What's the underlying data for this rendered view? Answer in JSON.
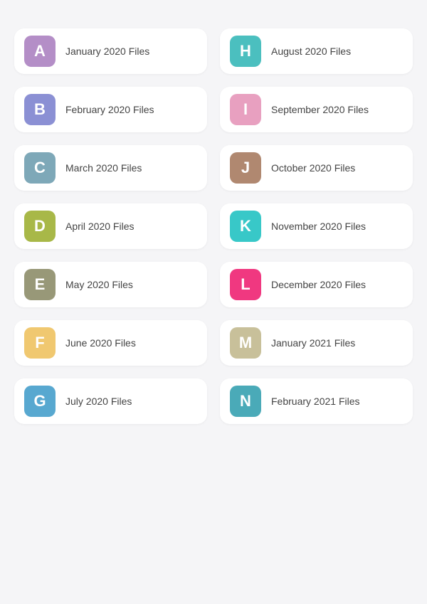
{
  "folders": [
    {
      "id": "A",
      "label": "January 2020 Files",
      "color": "#b48ec7"
    },
    {
      "id": "H",
      "label": "August 2020 Files",
      "color": "#4bbfbf"
    },
    {
      "id": "B",
      "label": "February 2020 Files",
      "color": "#8b90d4"
    },
    {
      "id": "I",
      "label": "September 2020 Files",
      "color": "#e8a0c0"
    },
    {
      "id": "C",
      "label": "March 2020 Files",
      "color": "#7ea8b8"
    },
    {
      "id": "J",
      "label": "October 2020 Files",
      "color": "#b08870"
    },
    {
      "id": "D",
      "label": "April 2020 Files",
      "color": "#a8b848"
    },
    {
      "id": "K",
      "label": "November 2020 Files",
      "color": "#38c8c8"
    },
    {
      "id": "E",
      "label": "May 2020 Files",
      "color": "#989878"
    },
    {
      "id": "L",
      "label": "December 2020 Files",
      "color": "#f03880"
    },
    {
      "id": "F",
      "label": "June 2020 Files",
      "color": "#f0c870"
    },
    {
      "id": "M",
      "label": "January 2021 Files",
      "color": "#c8c09a"
    },
    {
      "id": "G",
      "label": "July 2020 Files",
      "color": "#58a8d0"
    },
    {
      "id": "N",
      "label": "February 2021 Files",
      "color": "#4aaab8"
    }
  ]
}
